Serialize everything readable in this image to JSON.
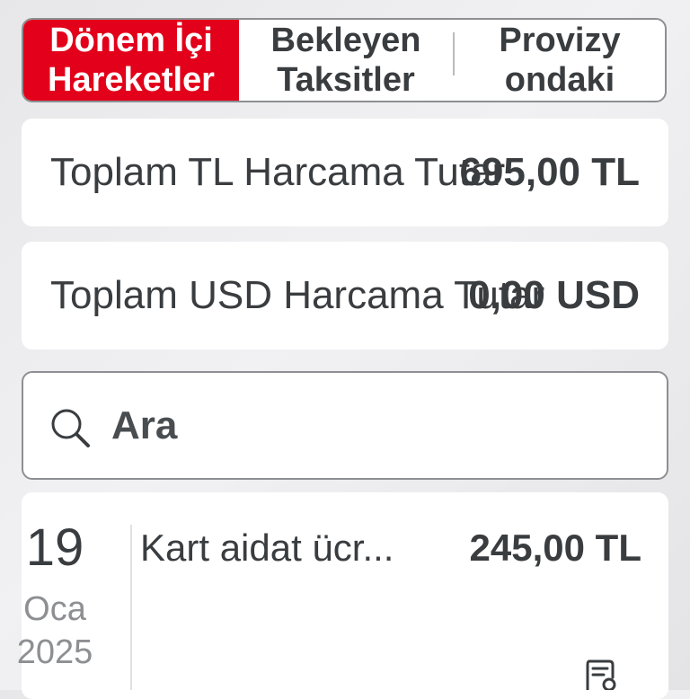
{
  "tabs": [
    {
      "label": "Dönem İçi\nHareketler",
      "active": true
    },
    {
      "label": "Bekleyen\nTaksitler",
      "active": false
    },
    {
      "label": "Provizy\nondaki",
      "active": false
    }
  ],
  "totals": {
    "tl": {
      "label": "Toplam TL Harcama Tutar",
      "value": "695,00 TL"
    },
    "usd": {
      "label": "Toplam USD Harcama Tutar",
      "value": "0,00 USD"
    }
  },
  "search": {
    "icon": "search-icon",
    "placeholder": "Ara"
  },
  "transactions": [
    {
      "day": "19",
      "month": "Oca",
      "year": "2025",
      "description": "Kart aidat ücr...",
      "amount": "245,00 TL",
      "icon": "receipt-icon"
    }
  ],
  "colors": {
    "accent": "#e2001a",
    "text": "#3a3d40",
    "muted": "#8d8f92",
    "background": "#ececee"
  }
}
